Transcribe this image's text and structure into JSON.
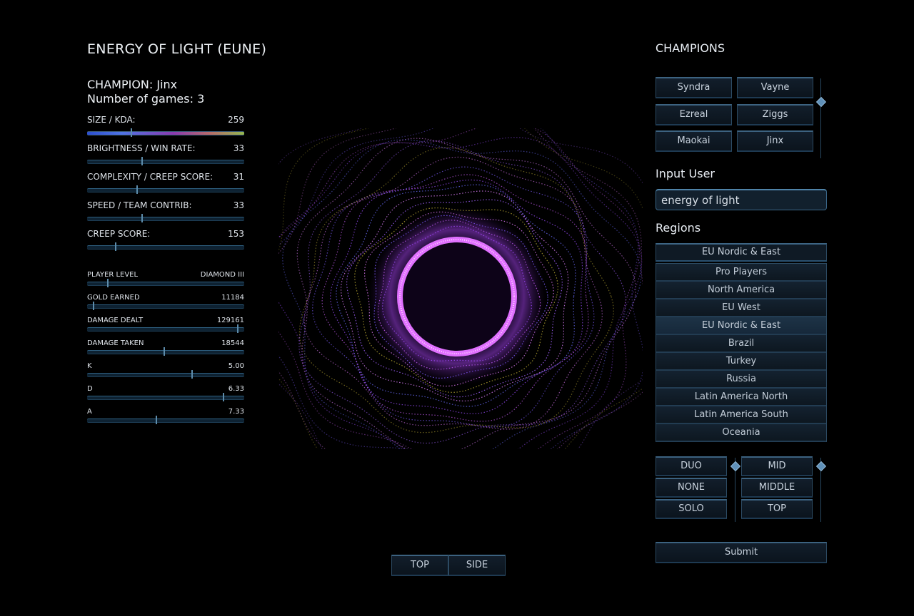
{
  "header": {
    "title": "ENERGY OF LIGHT (EUNE)",
    "champion_line": "CHAMPION: Jinx",
    "games_line": "Number of games: 3"
  },
  "stats": [
    {
      "label": "SIZE / KDA:",
      "value": "259",
      "level": 0.28
    },
    {
      "label": "BRIGHTNESS / WIN RATE:",
      "value": "33",
      "level": 0.35
    },
    {
      "label": "COMPLEXITY / CREEP SCORE:",
      "value": "31",
      "level": 0.32
    },
    {
      "label": "SPEED / TEAM CONTRIB:",
      "value": "33",
      "level": 0.35
    },
    {
      "label": "CREEP SCORE:",
      "value": "153",
      "level": 0.18
    }
  ],
  "details": [
    {
      "label": "PLAYER LEVEL",
      "value": "DIAMOND III",
      "level": 0.13
    },
    {
      "label": "GOLD EARNED",
      "value": "11184",
      "level": 0.04
    },
    {
      "label": "DAMAGE DEALT",
      "value": "129161",
      "level": 0.96
    },
    {
      "label": "DAMAGE TAKEN",
      "value": "18544",
      "level": 0.49
    },
    {
      "label": "K",
      "value": "5.00",
      "level": 0.67
    },
    {
      "label": "D",
      "value": "6.33",
      "level": 0.87
    },
    {
      "label": "A",
      "value": "7.33",
      "level": 0.44
    }
  ],
  "champions": {
    "heading": "CHAMPIONS",
    "items": [
      "Syndra",
      "Vayne",
      "Ezreal",
      "Ziggs",
      "Maokai",
      "Jinx"
    ]
  },
  "user_input": {
    "label": "Input User",
    "value": "energy of light"
  },
  "regions": {
    "label": "Regions",
    "selected": "EU Nordic & East",
    "options": [
      "Pro Players",
      "North America",
      "EU West",
      "EU Nordic & East",
      "Brazil",
      "Turkey",
      "Russia",
      "Latin America North",
      "Latin America South",
      "Oceania"
    ]
  },
  "queue_options": [
    "DUO",
    "NONE",
    "SOLO"
  ],
  "lane_options": [
    "MID",
    "MIDDLE",
    "TOP"
  ],
  "submit_label": "Submit",
  "view_buttons": [
    "TOP",
    "SIDE"
  ],
  "colors": {
    "ring": "#e070ff",
    "accent": "#3c6280",
    "background": "#000000"
  }
}
